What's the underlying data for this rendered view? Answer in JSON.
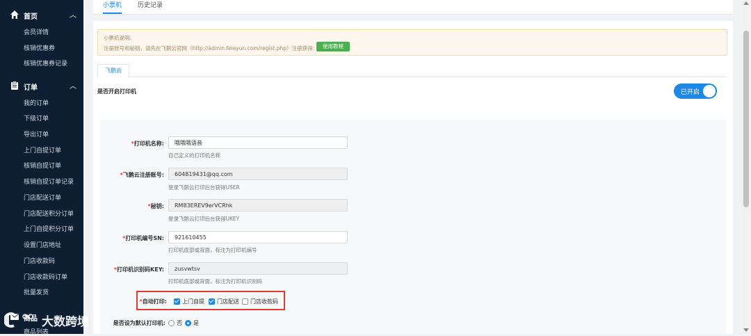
{
  "sidebar": {
    "home": {
      "title": "首页",
      "items": [
        "会员详情",
        "核销优惠券",
        "核销优惠券记录"
      ]
    },
    "orders": {
      "title": "订单",
      "items": [
        "我的订单",
        "下级订单",
        "导出订单",
        "上门自提订单",
        "核销自提订单",
        "核销自提订单记录",
        "门店配送订单",
        "门店配送积分订单",
        "上门自提积分订单",
        "设置门店地址",
        "门店收款码",
        "门店收款码订单",
        "批量发货"
      ]
    },
    "products": {
      "title": "商品",
      "items": [
        "商品列表"
      ]
    }
  },
  "top_tabs": [
    "小票机",
    "历史记录"
  ],
  "notice": {
    "title": "小票机说明:",
    "text": "注册账号和秘钥，请先在飞鹅云官网（http://admin.feieyun.com/regist.php）注册获得:",
    "button": "使用教程"
  },
  "sub_tab": "飞鹅云",
  "enable": {
    "label": "是否开启打印机",
    "toggle_text": "已开启",
    "on": true
  },
  "form": {
    "printer_name": {
      "label": "打印机名称:",
      "value": "哦哦哦语音",
      "help": "自己定义的打印机名称"
    },
    "account": {
      "label": "飞鹅云注册账号:",
      "value": "604819431@qq.com",
      "help": "登录飞鹅云打印后台获得USER"
    },
    "secret": {
      "label": "秘钥:",
      "value": "RM83EREV9erVCRhk",
      "help": "登录飞鹅云打印后台获得UKEY"
    },
    "sn": {
      "label": "打印机编号SN:",
      "value": "921610455",
      "help": "打印机底部或背面，标注为打印机编号"
    },
    "key": {
      "label": "打印机识别码KEY:",
      "value": "zusvwtsv",
      "help": "打印机底部或背面，标注为打印机识别码"
    },
    "auto_print": {
      "label": "自动打印:",
      "options": [
        {
          "label": "上门自提",
          "checked": true
        },
        {
          "label": "门店配送",
          "checked": true
        },
        {
          "label": "门店收款码",
          "checked": false
        }
      ]
    },
    "default_printer": {
      "label": "是否设为默认打印机:",
      "options": [
        {
          "label": "否",
          "selected": false
        },
        {
          "label": "是",
          "selected": true
        }
      ]
    }
  },
  "watermark": {
    "text": "大数跨境",
    "logo_text": "ID"
  },
  "colors": {
    "sidebar_bg": "#0f1f33",
    "accent": "#1e88e5",
    "required": "#e53935",
    "guide_button": "#4caf50",
    "notice_bg": "#fdf6ec"
  }
}
